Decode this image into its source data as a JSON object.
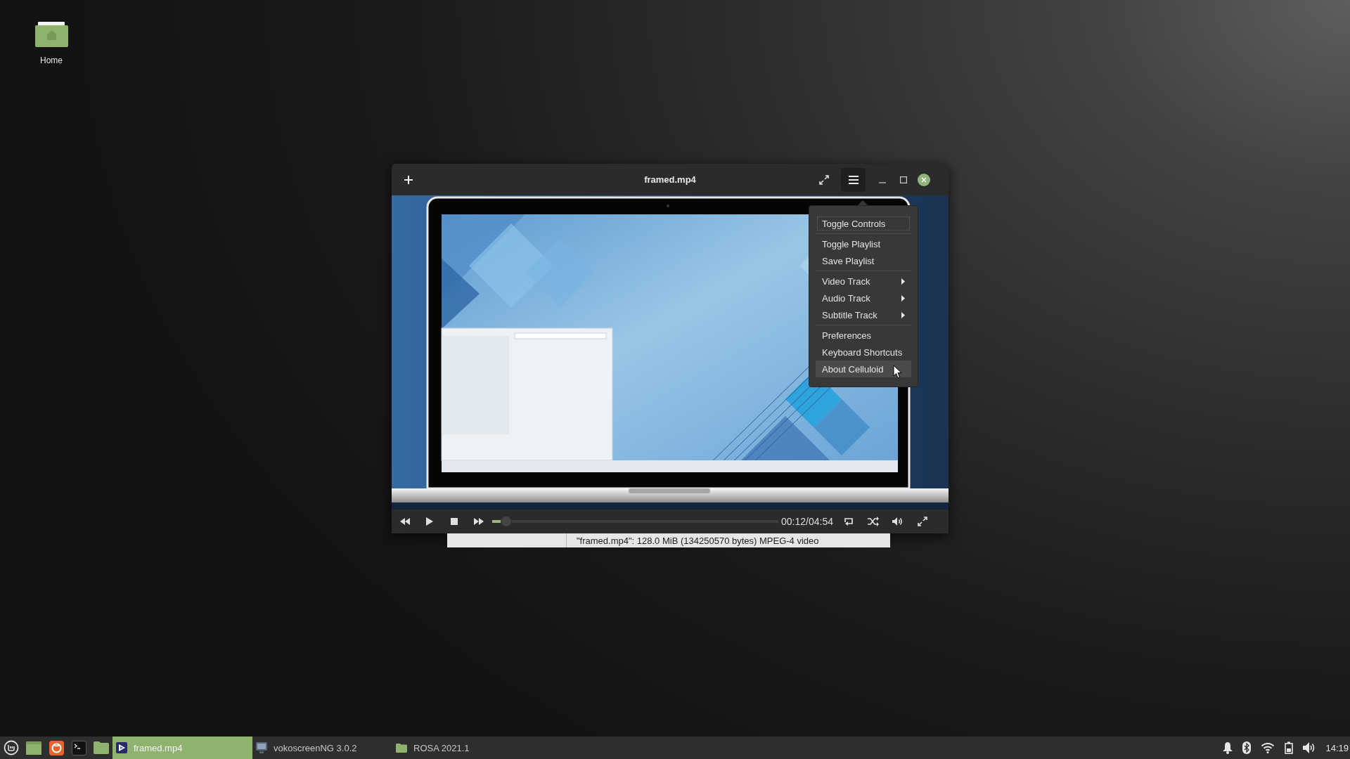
{
  "desktop": {
    "icons": [
      {
        "label": "Home"
      }
    ]
  },
  "window": {
    "title": "framed.mp4"
  },
  "menu": {
    "open": true,
    "sections": [
      {
        "items": [
          {
            "label": "Toggle Controls",
            "submenu": false,
            "focused": true,
            "hovered": false
          }
        ]
      },
      {
        "items": [
          {
            "label": "Toggle Playlist",
            "submenu": false,
            "focused": false,
            "hovered": false
          },
          {
            "label": "Save Playlist",
            "submenu": false,
            "focused": false,
            "hovered": false
          }
        ]
      },
      {
        "items": [
          {
            "label": "Video Track",
            "submenu": true,
            "focused": false,
            "hovered": false
          },
          {
            "label": "Audio Track",
            "submenu": true,
            "focused": false,
            "hovered": false
          },
          {
            "label": "Subtitle Track",
            "submenu": true,
            "focused": false,
            "hovered": false
          }
        ]
      },
      {
        "items": [
          {
            "label": "Preferences",
            "submenu": false,
            "focused": false,
            "hovered": false
          },
          {
            "label": "Keyboard Shortcuts",
            "submenu": false,
            "focused": false,
            "hovered": false
          },
          {
            "label": "About Celluloid",
            "submenu": false,
            "focused": false,
            "hovered": true
          }
        ]
      }
    ]
  },
  "player": {
    "seek": {
      "level": 0.05
    },
    "time": "00:12/04:54"
  },
  "file_info": {
    "text": "\"framed.mp4\": 128.0 MiB (134250570 bytes) MPEG-4 video"
  },
  "taskbar": {
    "tasks": [
      {
        "label": "framed.mp4",
        "kind": "player",
        "selected": true
      },
      {
        "label": "vokoscreenNG 3.0.2",
        "kind": "recorder",
        "selected": false
      },
      {
        "label": "ROSA 2021.1",
        "kind": "folder",
        "selected": false
      }
    ],
    "clock": "14:19"
  }
}
